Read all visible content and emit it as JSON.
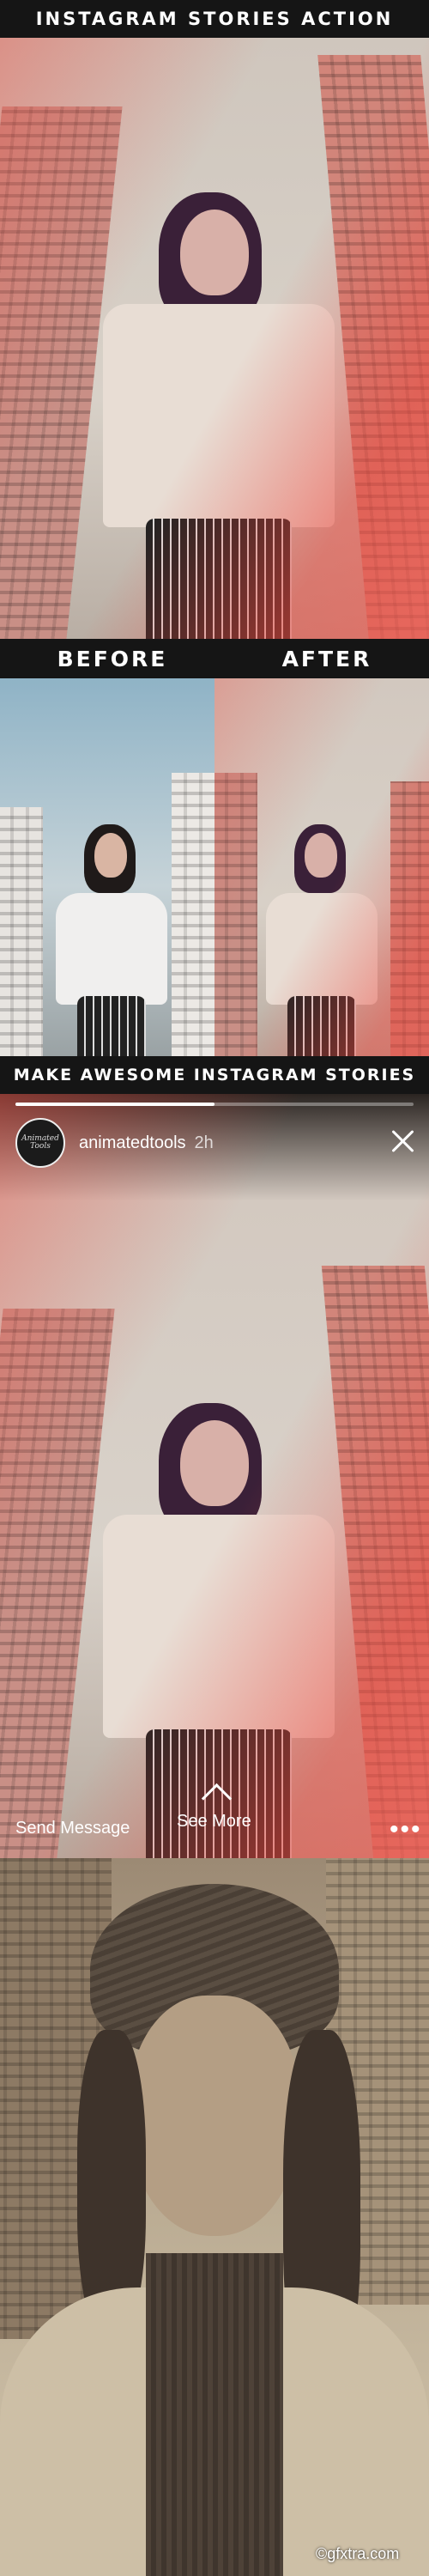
{
  "header": {
    "title": "INSTAGRAM STORIES ACTION"
  },
  "compare": {
    "before_label": "BEFORE",
    "after_label": "AFTER"
  },
  "banner": {
    "title": "MAKE AWESOME INSTAGRAM STORIES"
  },
  "story": {
    "username": "animatedtools",
    "time_ago": "2h",
    "avatar_text": "Animated Tools",
    "send_message": "Send Message",
    "see_more": "See More",
    "progress": 0.5,
    "close_icon": "close-icon",
    "more_icon": "more-dots-icon"
  },
  "watermark": "©gfxtra.com",
  "colors": {
    "bar_bg": "#151515",
    "accent_red": "#e0493f",
    "wash_pink": "#f1a18f"
  }
}
